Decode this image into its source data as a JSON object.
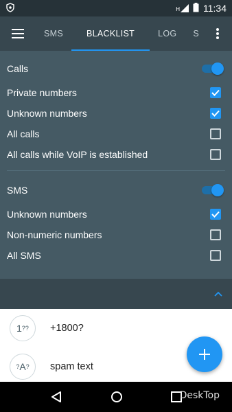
{
  "status_bar": {
    "time": "11:34",
    "signal_letter": "H",
    "icons": [
      "shield-icon",
      "signal-icon",
      "battery-icon"
    ]
  },
  "tabs": [
    {
      "label": "SMS",
      "active": false
    },
    {
      "label": "BLACKLIST",
      "active": true
    },
    {
      "label": "LOG",
      "active": false
    },
    {
      "label": "S",
      "active": false
    }
  ],
  "calls": {
    "title": "Calls",
    "enabled": true,
    "options": [
      {
        "label": "Private numbers",
        "checked": true
      },
      {
        "label": "Unknown numbers",
        "checked": true
      },
      {
        "label": "All calls",
        "checked": false
      },
      {
        "label": "All calls while VoIP is established",
        "checked": false
      }
    ]
  },
  "sms": {
    "title": "SMS",
    "enabled": true,
    "options": [
      {
        "label": "Unknown numbers",
        "checked": true
      },
      {
        "label": "Non-numeric numbers",
        "checked": false
      },
      {
        "label": "All SMS",
        "checked": false
      }
    ]
  },
  "list": [
    {
      "avatar_main": "1",
      "avatar_sub": "??",
      "text": "+1800?"
    },
    {
      "avatar_pre": "?",
      "avatar_main": "A",
      "avatar_sub": "?",
      "text": "spam text"
    }
  ],
  "watermark": "DeskTop",
  "colors": {
    "accent": "#2196f3",
    "toolbar": "#37474f",
    "panel": "#455a64",
    "status_bar": "#263238"
  }
}
